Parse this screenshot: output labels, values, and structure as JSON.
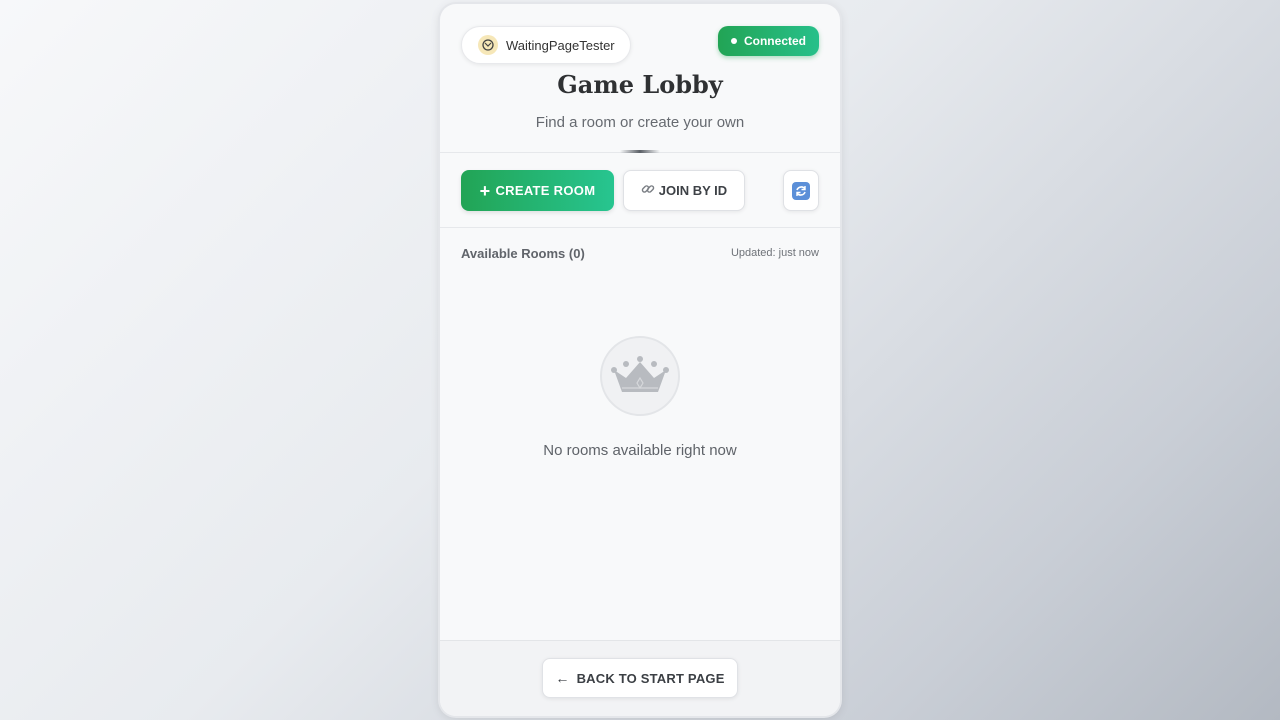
{
  "colors": {
    "accent_green": "#22a455",
    "accent_teal": "#27c590",
    "refresh_blue": "#5b8fd8",
    "text_dark": "#2f3133",
    "text_muted": "#666a70"
  },
  "user": {
    "name": "WaitingPageTester",
    "avatar_icon": "avatar-emblem-icon"
  },
  "status": {
    "label": "Connected",
    "icon": "status-dot-icon"
  },
  "header": {
    "title": "Game Lobby",
    "subtitle": "Find a room or create your own"
  },
  "toolbar": {
    "create_label": "CREATE ROOM",
    "create_icon": "plus-icon",
    "join_label": "JOIN BY ID",
    "join_icon": "link-icon",
    "refresh_icon": "refresh-icon"
  },
  "rooms": {
    "title": "Available Rooms (0)",
    "updated": "Updated: just now",
    "empty_icon": "crown-icon",
    "empty_message": "No rooms available right now"
  },
  "footer": {
    "back_label": "BACK TO START PAGE",
    "back_icon": "arrow-left-icon"
  }
}
